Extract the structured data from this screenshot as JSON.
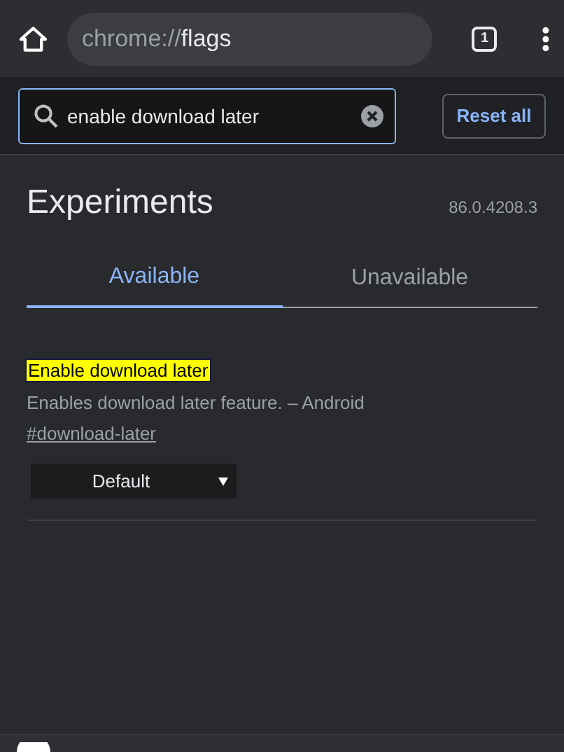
{
  "toolbar": {
    "address_scheme": "chrome://",
    "address_host": "flags",
    "tab_count": "1"
  },
  "search": {
    "value": "enable download later",
    "reset_button": "Reset all"
  },
  "header": {
    "title": "Experiments",
    "version": "86.0.4208.3"
  },
  "tabs": [
    {
      "label": "Available",
      "selected": true
    },
    {
      "label": "Unavailable",
      "selected": false
    }
  ],
  "flags": [
    {
      "title": "Enable download later",
      "highlighted": true,
      "description": "Enables download later feature. – Android",
      "link": "#download-later",
      "value": "Default"
    }
  ]
}
